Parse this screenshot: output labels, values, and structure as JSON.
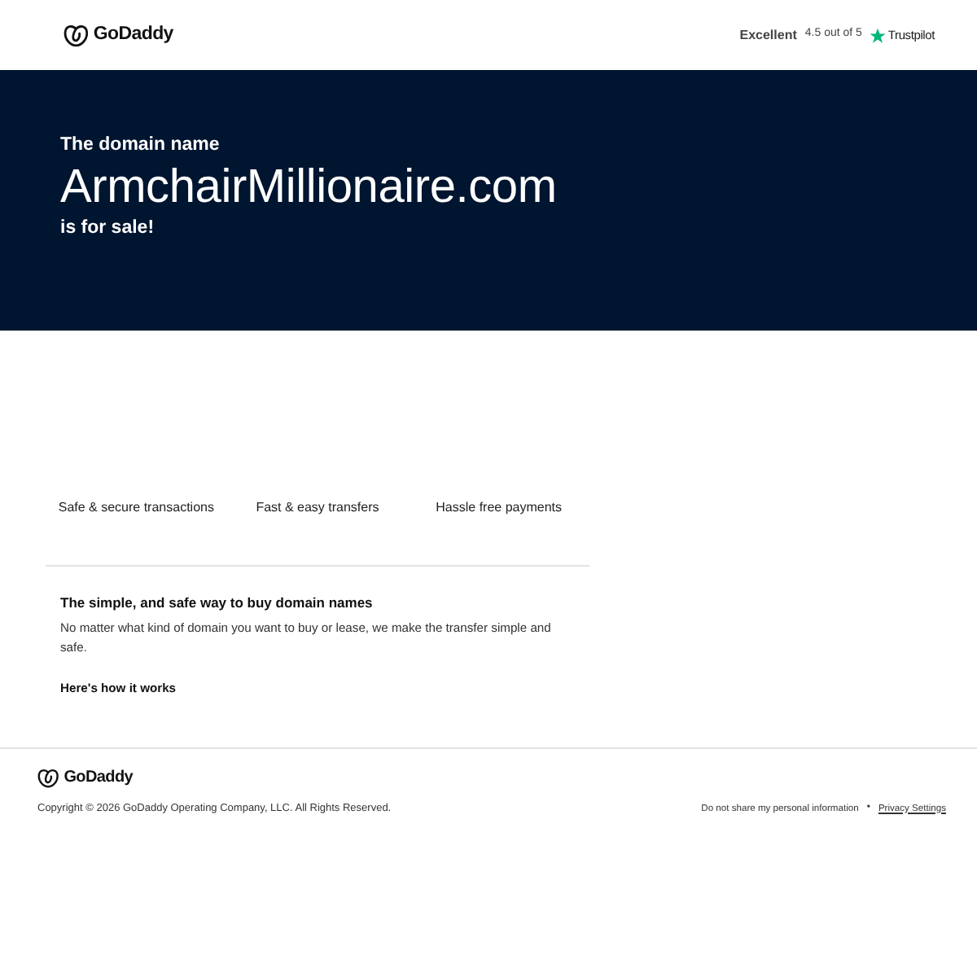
{
  "header": {
    "logo": {
      "text": "GoDaddy"
    },
    "rating": {
      "label": "Excellent",
      "score": "4.5 out of 5",
      "brand": "Trustpilot"
    }
  },
  "hero": {
    "intro": "The domain name",
    "domain": "ArmchairMillionaire.com",
    "tagline": "is for sale!"
  },
  "features": [
    "Safe & secure transactions",
    "Fast & easy transfers",
    "Hassle free payments"
  ],
  "info": {
    "heading": "The simple, and safe way to buy domain names",
    "body": "No matter what kind of domain you want to buy or lease, we make the transfer simple and safe.",
    "link": "Here's how it works"
  },
  "footer": {
    "logo": {
      "text": "GoDaddy"
    },
    "copyright": "Copyright © 2026 GoDaddy Operating Company, LLC. All Rights Reserved.",
    "separator": "•",
    "links": [
      {
        "label": "Do not share my personal information",
        "underlined": false
      },
      {
        "label": "Privacy Settings",
        "underlined": true
      }
    ]
  }
}
